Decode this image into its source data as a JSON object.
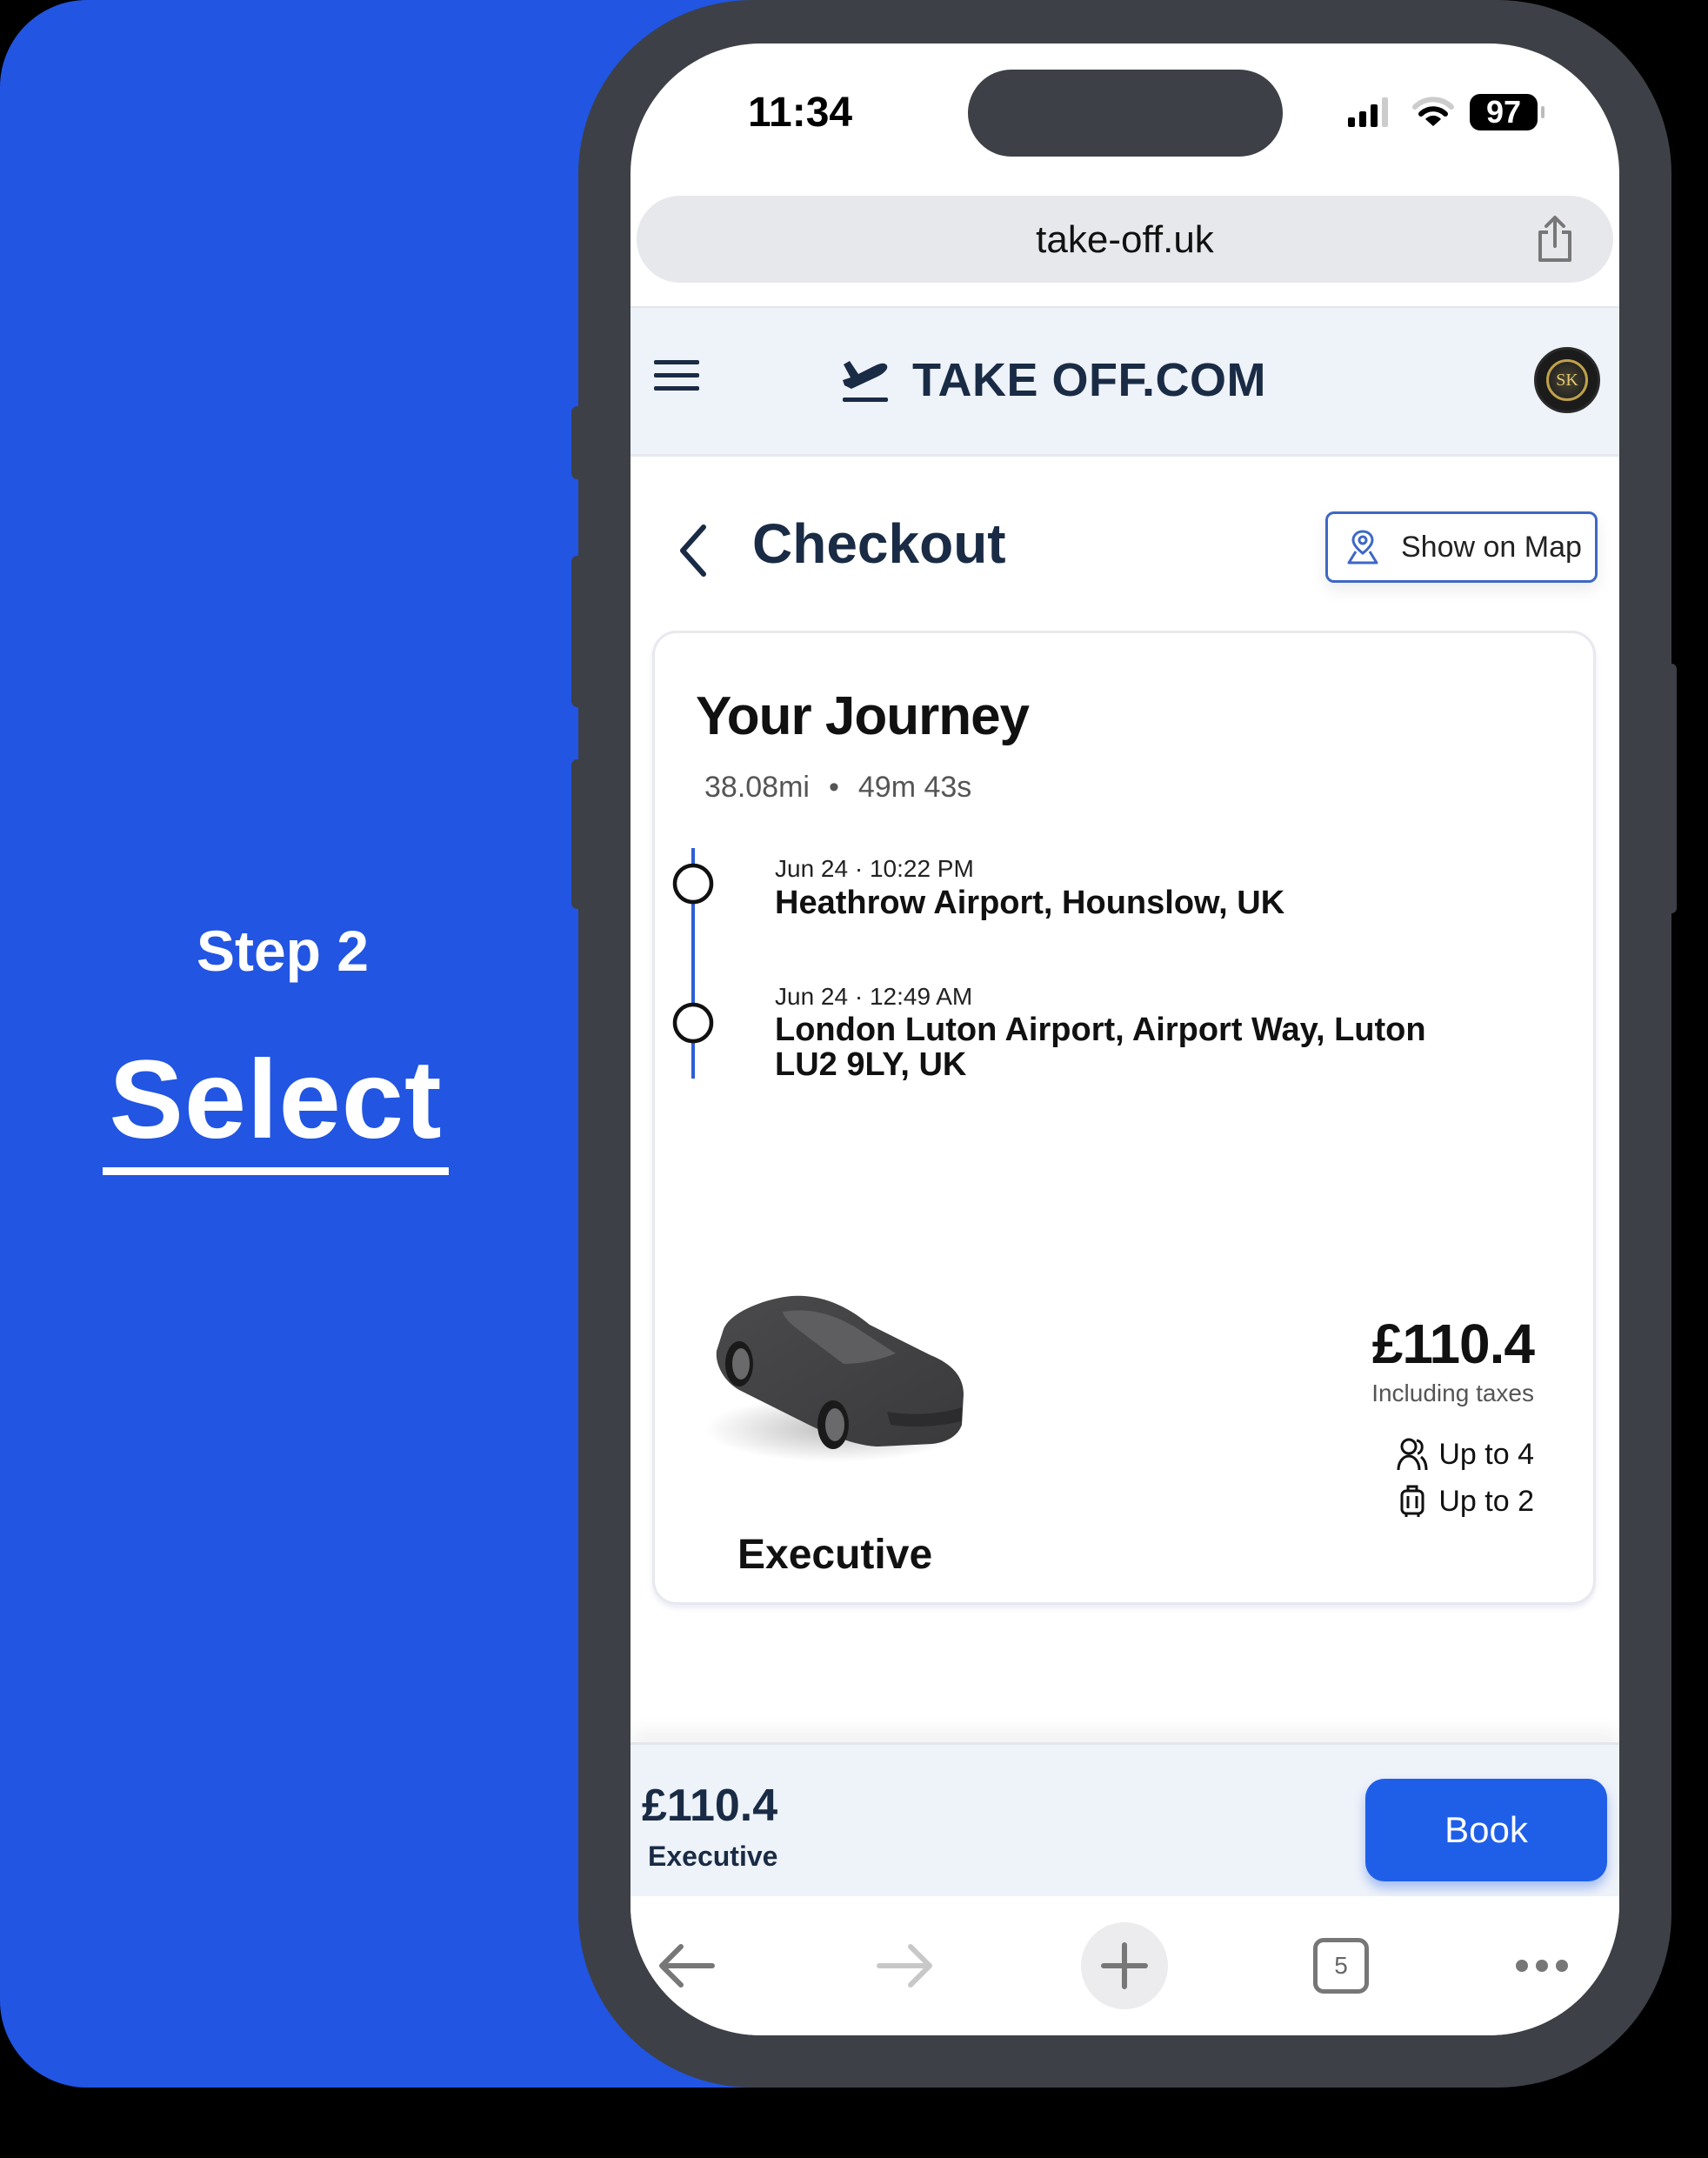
{
  "promo": {
    "step_label": "Step 2",
    "title": "Select",
    "background_color": "#2155e2"
  },
  "status_bar": {
    "time": "11:34",
    "battery": "97",
    "icons": [
      "signal-icon",
      "wifi-icon",
      "battery-icon"
    ]
  },
  "browser": {
    "url": "take-off.uk",
    "share_icon": "share-icon",
    "nav": {
      "back_icon": "arrow-left-icon",
      "forward_icon": "arrow-right-icon",
      "new_tab_icon": "plus-icon",
      "tab_count": "5",
      "more_icon": "more-dots-icon"
    }
  },
  "site_header": {
    "brand_name": "TAKE OFF.COM",
    "brand_icon": "airplane-departure-icon",
    "menu_icon": "hamburger-menu-icon",
    "avatar_initials": "SK"
  },
  "checkout": {
    "title": "Checkout",
    "back_icon": "chevron-left-icon",
    "show_map_label": "Show on Map",
    "show_map_icon": "map-pin-icon"
  },
  "journey": {
    "title": "Your Journey",
    "distance": "38.08mi",
    "separator": "•",
    "duration": "49m 43s",
    "stops": [
      {
        "date": "Jun 24 · 10:22 PM",
        "name": "Heathrow Airport, Hounslow, UK"
      },
      {
        "date": "Jun 24 · 12:49 AM",
        "name": "London Luton Airport, Airport Way, Luton LU2 9LY, UK"
      }
    ],
    "accent_color": "#2d5fd6"
  },
  "vehicle": {
    "name": "Executive",
    "price": "£110.4",
    "price_note": "Including taxes",
    "passengers": "Up to 4",
    "luggage": "Up to 2"
  },
  "action_bar": {
    "price": "£110.4",
    "vehicle": "Executive",
    "book_label": "Book",
    "book_color": "#1f5fe8"
  }
}
